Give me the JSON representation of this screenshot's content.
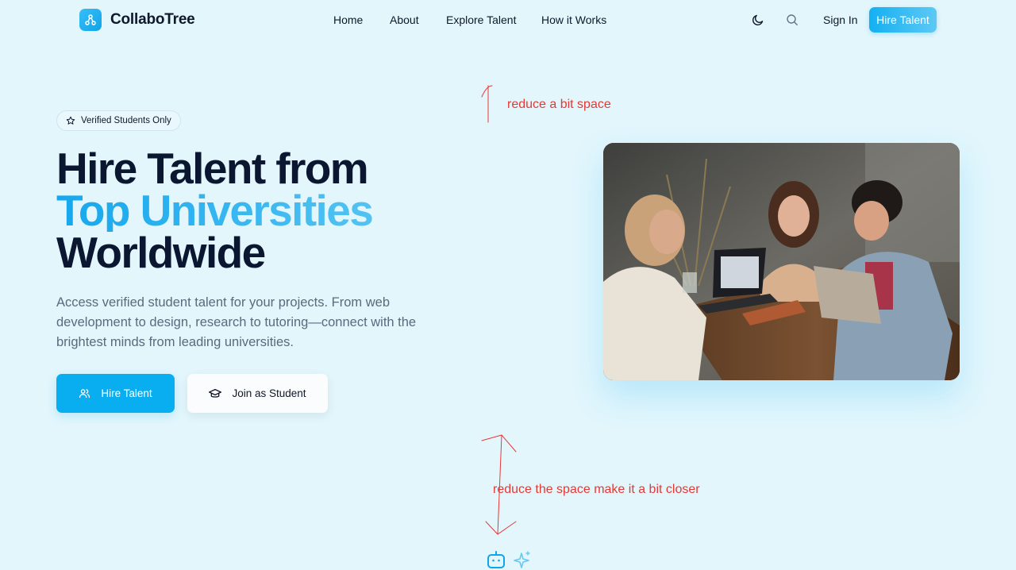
{
  "app": {
    "logo_text": "CollaboTree"
  },
  "nav": {
    "links": [
      {
        "label": "Home"
      },
      {
        "label": "About"
      },
      {
        "label": "Explore Talent"
      },
      {
        "label": "How it Works"
      }
    ],
    "theme_icon": "moon-icon",
    "search_icon": "search-icon",
    "sign_in": "Sign In",
    "hire_talent": "Hire Talent"
  },
  "hero": {
    "badge": "Verified Students Only",
    "headline_line1": "Hire Talent from",
    "headline_line2": "Top Universities",
    "headline_line3": "Worldwide",
    "description": "Access verified student talent for your projects. From web development to design, research to tutoring—connect with the brightest minds from leading universities.",
    "primary_button": "Hire Talent",
    "secondary_button": "Join as Student"
  },
  "annotations": {
    "top_note": "reduce a bit space",
    "bottom_note": "reduce the space make it a bit closer"
  },
  "colors": {
    "background": "#e2f6fc",
    "accent": "#09aef0",
    "annotation": "#e53935",
    "heading": "#0b1630"
  },
  "bottom_icons": [
    "robot-icon",
    "sparkles-icon"
  ]
}
